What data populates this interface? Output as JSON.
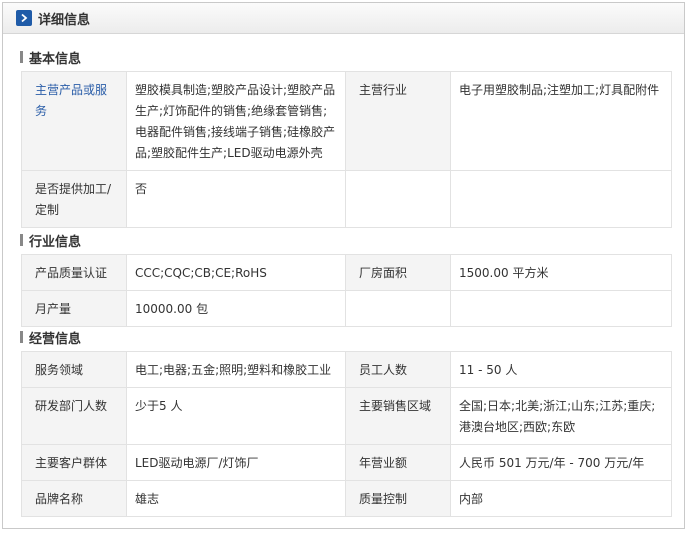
{
  "header": {
    "title": "详细信息",
    "icon": "chevron-right-icon"
  },
  "sections": {
    "basic": {
      "title": "基本信息",
      "rows": [
        [
          "主营产品或服务",
          "塑胶模具制造;塑胶产品设计;塑胶产品生产;灯饰配件的销售;绝缘套管销售;电器配件销售;接线端子销售;硅橡胶产品;塑胶配件生产;LED驱动电源外壳",
          "主营行业",
          "电子用塑胶制品;注塑加工;灯具配附件"
        ],
        [
          "是否提供加工/定制",
          "否",
          "",
          ""
        ]
      ]
    },
    "industry": {
      "title": "行业信息",
      "rows": [
        [
          "产品质量认证",
          "CCC;CQC;CB;CE;RoHS",
          "厂房面积",
          "1500.00 平方米"
        ],
        [
          "月产量",
          "10000.00 包",
          "",
          ""
        ]
      ]
    },
    "business": {
      "title": "经营信息",
      "rows": [
        [
          "服务领域",
          "电工;电器;五金;照明;塑料和橡胶工业",
          "员工人数",
          "11 - 50 人"
        ],
        [
          "研发部门人数",
          "少于5 人",
          "主要销售区域",
          "全国;日本;北美;浙江;山东;江苏;重庆;港澳台地区;西欧;东欧"
        ],
        [
          "主要客户群体",
          "LED驱动电源厂/灯饰厂",
          "年营业额",
          "人民币 501 万元/年 - 700 万元/年"
        ],
        [
          "品牌名称",
          "雄志",
          "质量控制",
          "内部"
        ]
      ]
    }
  },
  "colors": {
    "accent": "#1f5ba8",
    "link": "#2a5da8",
    "label_bg": "#f4f4f4"
  }
}
